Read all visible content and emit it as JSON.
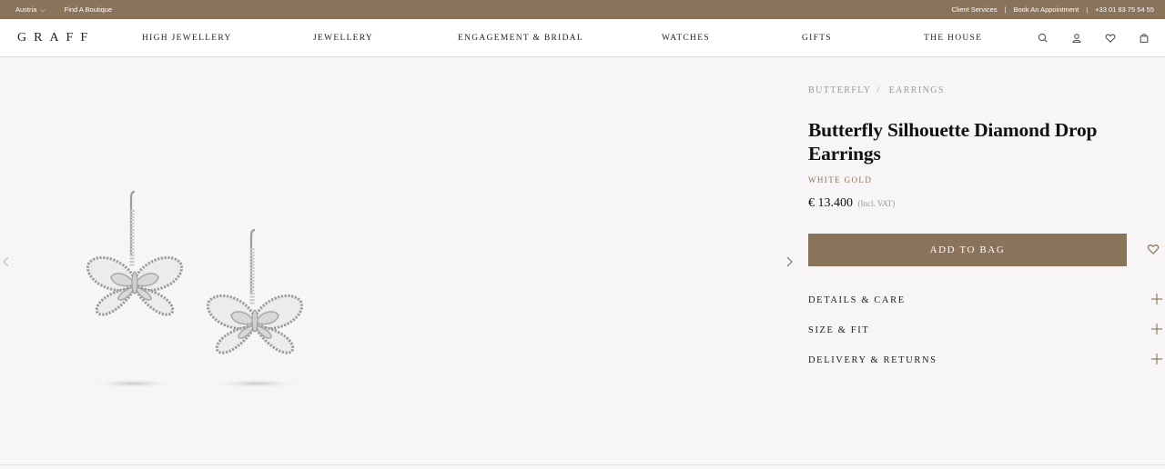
{
  "topbar": {
    "country": "Austria",
    "find_boutique": "Find A Boutique",
    "client_services": "Client Services",
    "separator": "|",
    "book_appointment": "Book An Appointment",
    "phone": "+33 01 83 75 54 55"
  },
  "nav": {
    "logo": "GRAFF",
    "items": [
      "HIGH JEWELLERY",
      "JEWELLERY",
      "ENGAGEMENT & BRIDAL",
      "WATCHES",
      "GIFTS",
      "THE HOUSE"
    ],
    "icons": [
      "search-icon",
      "account-icon",
      "heart-icon",
      "bag-icon"
    ]
  },
  "product": {
    "breadcrumb": [
      "BUTTERFLY",
      "EARRINGS"
    ],
    "breadcrumb_separator": "/",
    "title": "Butterfly Silhouette Diamond Drop Earrings",
    "metal": "WHITE GOLD",
    "price": "€ 13.400",
    "vat_note": "(Incl. VAT)",
    "add_to_bag": "ADD TO BAG",
    "accordion": [
      "DETAILS & CARE",
      "SIZE & FIT",
      "DELIVERY & RETURNS"
    ]
  },
  "colors": {
    "brand": "#8a735b",
    "background": "#f7f5f5",
    "text": "#222222"
  }
}
